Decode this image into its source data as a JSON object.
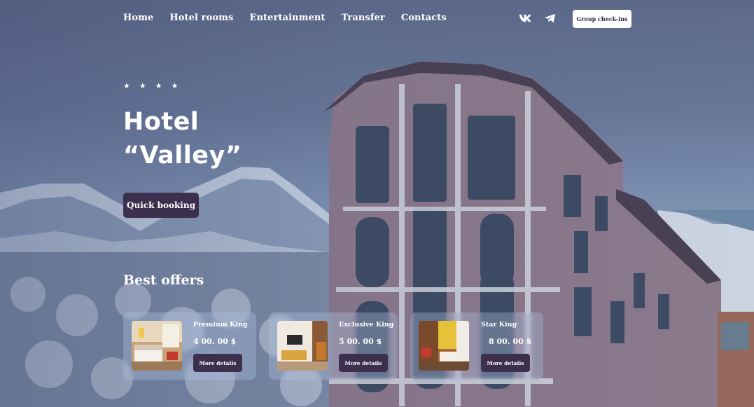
{
  "nav": {
    "items": [
      {
        "label": "Home"
      },
      {
        "label": "Hotel rooms"
      },
      {
        "label": "Entertainment"
      },
      {
        "label": "Transfer"
      },
      {
        "label": "Contacts"
      }
    ]
  },
  "socials": [
    {
      "icon": "vk-icon"
    },
    {
      "icon": "telegram-icon"
    }
  ],
  "header": {
    "group_checkin_label": "Group check-ins"
  },
  "hero": {
    "stars": [
      "★",
      "★",
      "★",
      "★"
    ],
    "title_line1": "Hotel",
    "title_line2": "“Valley”",
    "quick_booking_label": "Quick booking"
  },
  "offers": {
    "title": "Best offers",
    "items": [
      {
        "name": "Premium King",
        "price": "4 00. 00 $",
        "button_label": "More details"
      },
      {
        "name": "Exclusive King",
        "price": "5 00. 00 $",
        "button_label": "More details"
      },
      {
        "name": "Star King",
        "price": "8 00. 00 $",
        "button_label": "More details"
      }
    ]
  },
  "colors": {
    "accent_button": "#3d2f4e",
    "white_button": "#ffffff",
    "card_glass": "#afc3e1"
  }
}
